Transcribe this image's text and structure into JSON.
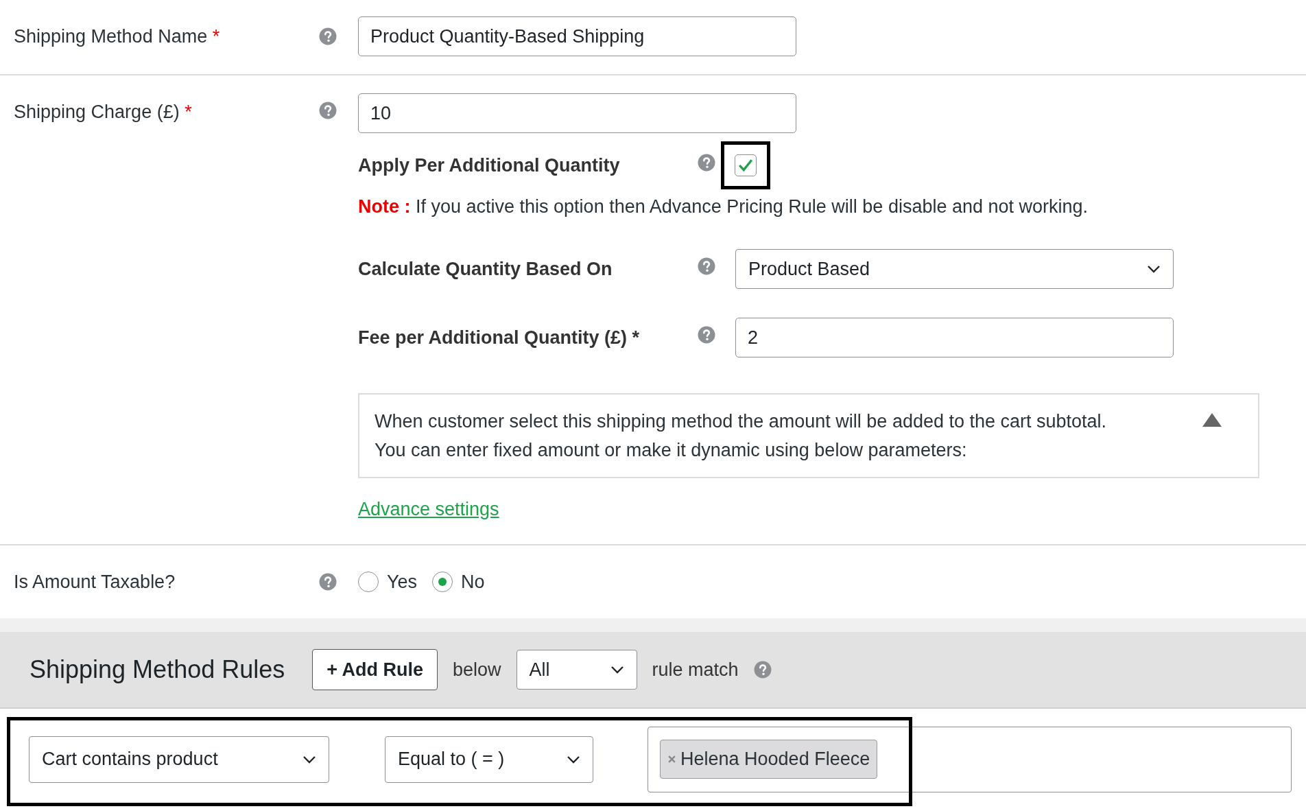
{
  "shipping_method_name": {
    "label": "Shipping Method Name",
    "required_mark": "*",
    "value": "Product Quantity-Based Shipping"
  },
  "shipping_charge": {
    "label": "Shipping Charge (£)",
    "required_mark": "*",
    "value": "10",
    "apply_per_additional_quantity": {
      "label": "Apply Per Additional Quantity",
      "checked": true,
      "highlighted": true
    },
    "note": {
      "label": "Note :",
      "text": "If you active this option then Advance Pricing Rule will be disable and not working."
    },
    "calculate_quantity_based_on": {
      "label": "Calculate Quantity Based On",
      "value": "Product Based"
    },
    "fee_per_additional_quantity": {
      "label": "Fee per Additional Quantity (£) *",
      "value": "2"
    },
    "info_box": {
      "lines": [
        "When customer select this shipping method the amount will be added to the cart subtotal.",
        "You can enter fixed amount or make it dynamic using below parameters:"
      ],
      "expanded": true
    },
    "advance_settings_link": "Advance settings"
  },
  "is_amount_taxable": {
    "label": "Is Amount Taxable?",
    "options": [
      {
        "label": "Yes",
        "selected": false
      },
      {
        "label": "No",
        "selected": true
      }
    ]
  },
  "shipping_method_rules": {
    "title": "Shipping Method Rules",
    "add_rule_button": "+ Add Rule",
    "below_text": "below",
    "match_select": "All",
    "rule_match_text": "rule match",
    "rules": [
      {
        "condition": "Cart contains product",
        "operator": "Equal to ( = )",
        "tags": [
          "Helena Hooded Fleece"
        ],
        "highlighted": true
      }
    ]
  }
}
